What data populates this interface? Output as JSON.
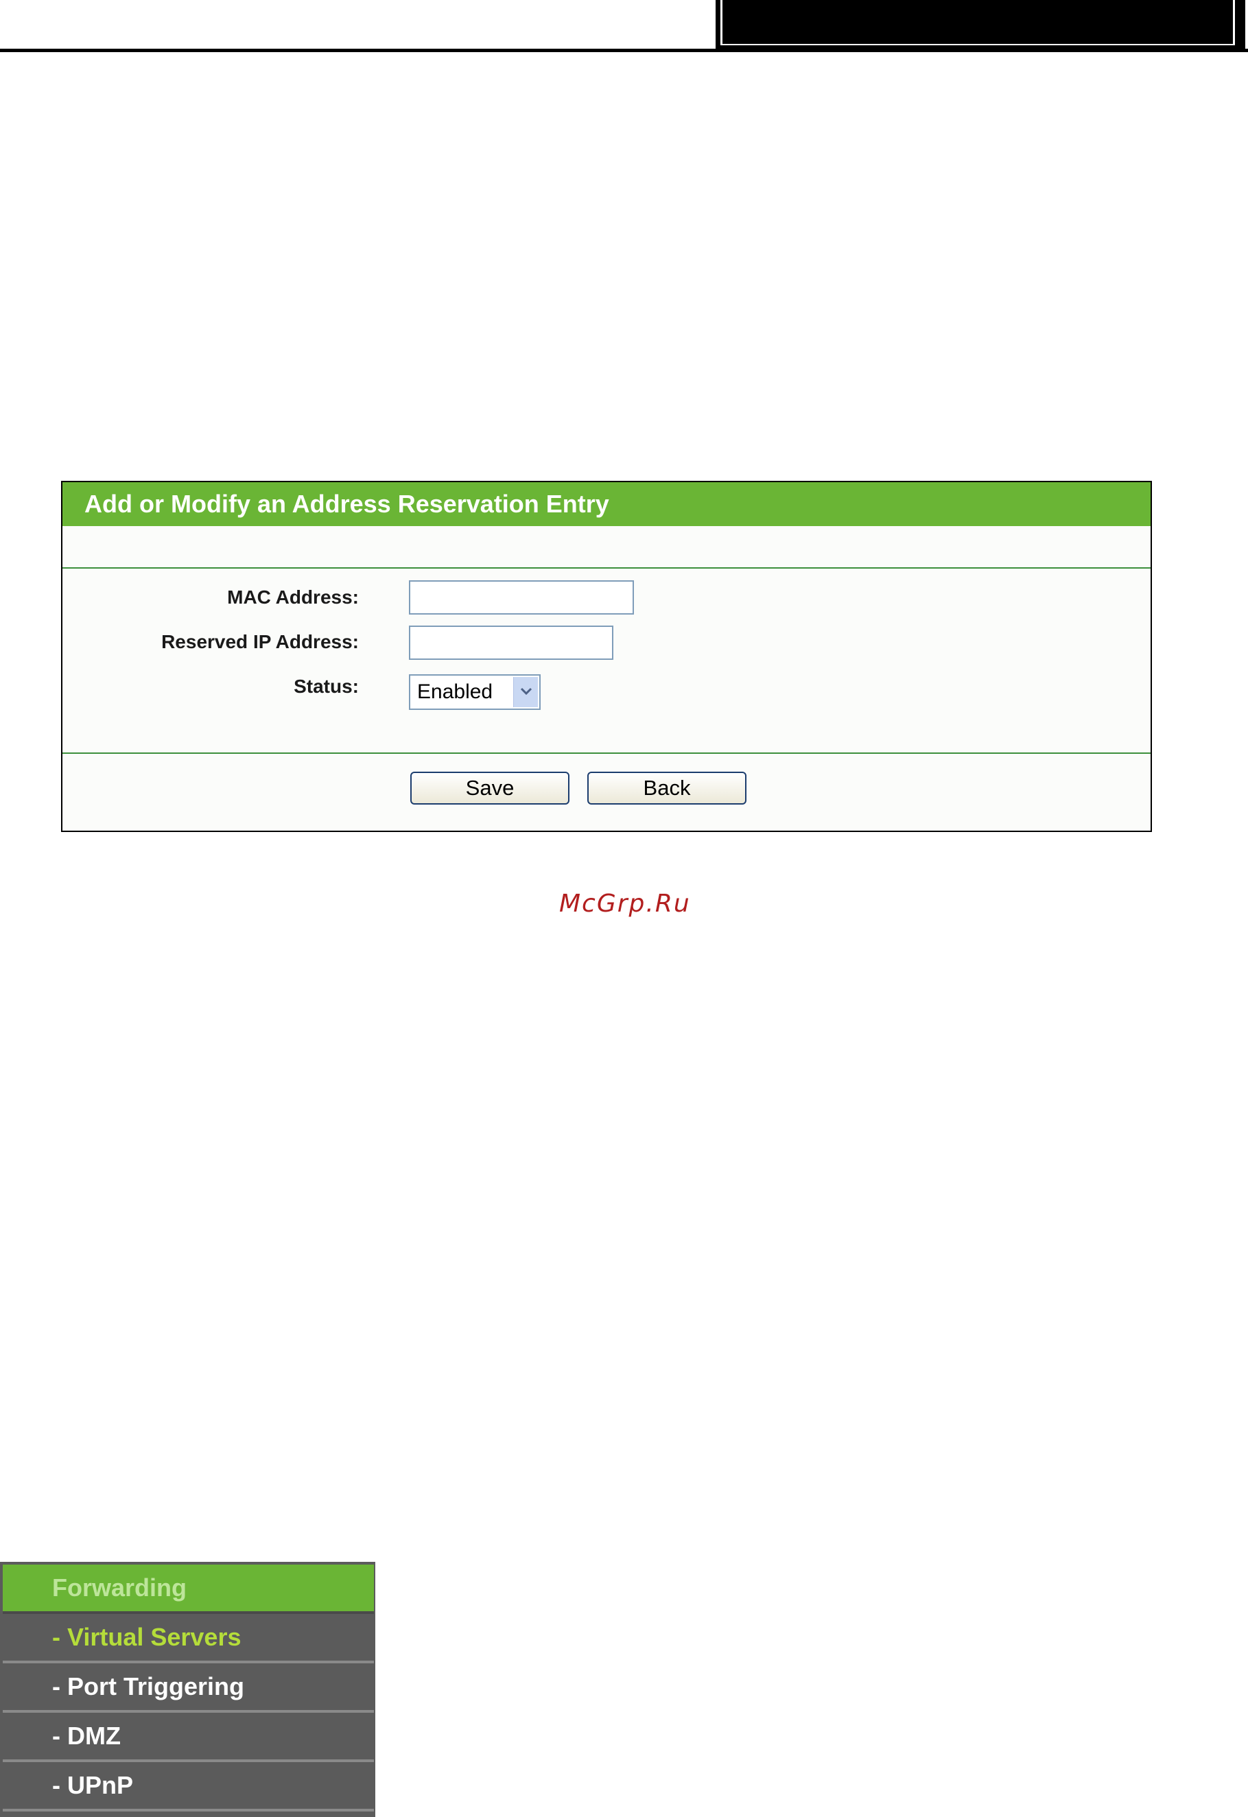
{
  "panel": {
    "title": "Add or Modify an Address Reservation Entry",
    "fields": [
      {
        "label": "MAC Address:",
        "value": ""
      },
      {
        "label": "Reserved IP Address:",
        "value": ""
      }
    ],
    "status": {
      "label": "Status:",
      "selected": "Enabled"
    },
    "buttons": {
      "save": "Save",
      "back": "Back"
    }
  },
  "watermark": "McGrp.Ru",
  "menu": {
    "header": "Forwarding",
    "items": [
      {
        "label": "- Virtual Servers",
        "active": true
      },
      {
        "label": "- Port Triggering",
        "active": false
      },
      {
        "label": "- DMZ",
        "active": false
      },
      {
        "label": "- UPnP",
        "active": false
      }
    ]
  },
  "colors": {
    "accent_green": "#6ab535",
    "menu_background": "#5b5b5b",
    "active_menu_text": "#b5dd3a",
    "watermark": "#b21e1e"
  }
}
